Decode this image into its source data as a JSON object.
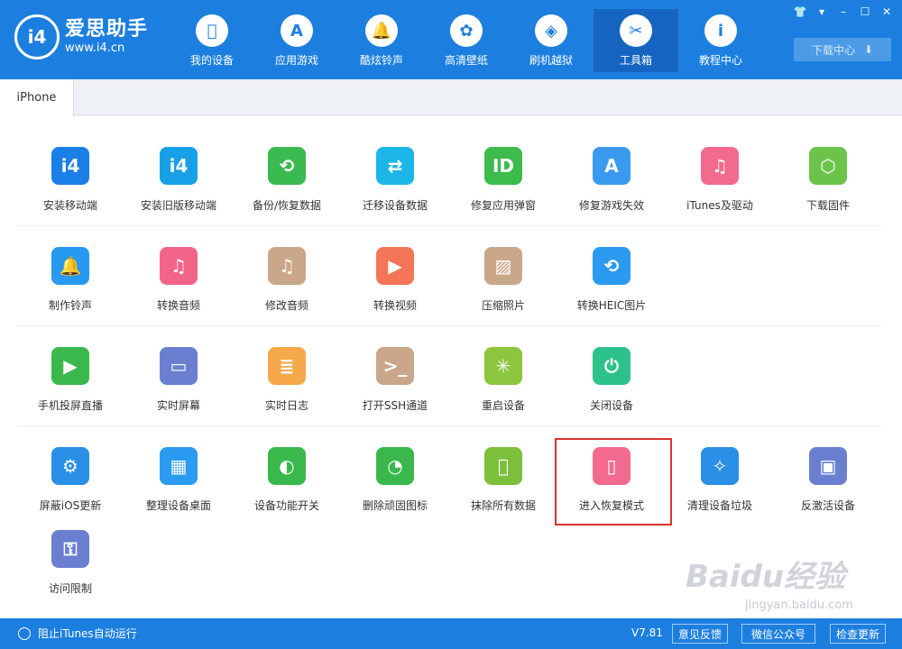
{
  "app": {
    "name": "爱思助手",
    "url": "www.i4.cn",
    "badge": "i4"
  },
  "nav": [
    {
      "label": "我的设备",
      "icon": "apple-icon",
      "glyph": ""
    },
    {
      "label": "应用游戏",
      "icon": "app-store-icon",
      "glyph": "A"
    },
    {
      "label": "酷炫铃声",
      "icon": "bell-icon",
      "glyph": "🔔"
    },
    {
      "label": "高清壁纸",
      "icon": "flower-icon",
      "glyph": "✿"
    },
    {
      "label": "刷机越狱",
      "icon": "dropbox-icon",
      "glyph": "◈"
    },
    {
      "label": "工具箱",
      "icon": "tools-icon",
      "glyph": "✂"
    },
    {
      "label": "教程中心",
      "icon": "info-icon",
      "glyph": "i"
    }
  ],
  "download_center": "下载中心",
  "tab": "iPhone",
  "tools": [
    [
      {
        "label": "安装移动端",
        "icon": "i4-app-icon",
        "color": "#1a7fe6",
        "glyph": "i4"
      },
      {
        "label": "安装旧版移动端",
        "icon": "i4-legacy-app-icon",
        "color": "#18a0e6",
        "glyph": "i4"
      },
      {
        "label": "备份/恢复数据",
        "icon": "backup-restore-icon",
        "color": "#3aba4f",
        "glyph": "⟲"
      },
      {
        "label": "迁移设备数据",
        "icon": "transfer-data-icon",
        "color": "#1cb6e8",
        "glyph": "⇄"
      },
      {
        "label": "修复应用弹窗",
        "icon": "apple-id-fix-icon",
        "color": "#3dbb4c",
        "glyph": "ID"
      },
      {
        "label": "修复游戏失效",
        "icon": "game-fix-icon",
        "color": "#3a9af0",
        "glyph": "A"
      },
      {
        "label": "iTunes及驱动",
        "icon": "itunes-icon",
        "color": "#f26a8d",
        "glyph": "♫"
      },
      {
        "label": "下载固件",
        "icon": "firmware-box-icon",
        "color": "#6cc34a",
        "glyph": "⬡"
      }
    ],
    [
      {
        "label": "制作铃声",
        "icon": "ringtone-bell-icon",
        "color": "#2799f0",
        "glyph": "🔔"
      },
      {
        "label": "转换音频",
        "icon": "convert-audio-icon",
        "color": "#f3648a",
        "glyph": "♫"
      },
      {
        "label": "修改音频",
        "icon": "edit-audio-icon",
        "color": "#caa78a",
        "glyph": "♫"
      },
      {
        "label": "转换视频",
        "icon": "convert-video-icon",
        "color": "#f47558",
        "glyph": "▶"
      },
      {
        "label": "压缩照片",
        "icon": "compress-photo-icon",
        "color": "#caa78a",
        "glyph": "▨"
      },
      {
        "label": "转换HEIC图片",
        "icon": "heic-convert-icon",
        "color": "#2a9bf0",
        "glyph": "⟲"
      }
    ],
    [
      {
        "label": "手机投屏直播",
        "icon": "screen-cast-icon",
        "color": "#3ab84c",
        "glyph": "▶"
      },
      {
        "label": "实时屏幕",
        "icon": "realtime-screen-icon",
        "color": "#6a7fd0",
        "glyph": "▭"
      },
      {
        "label": "实时日志",
        "icon": "realtime-log-icon",
        "color": "#f6a94a",
        "glyph": "≣"
      },
      {
        "label": "打开SSH通道",
        "icon": "ssh-terminal-icon",
        "color": "#caa78a",
        "glyph": ">_"
      },
      {
        "label": "重启设备",
        "icon": "restart-device-icon",
        "color": "#8cc63f",
        "glyph": "✳"
      },
      {
        "label": "关闭设备",
        "icon": "power-off-icon",
        "color": "#2dc28b",
        "glyph": "⏻"
      }
    ],
    [
      {
        "label": "屏蔽iOS更新",
        "icon": "block-update-icon",
        "color": "#2a8fe6",
        "glyph": "⚙"
      },
      {
        "label": "整理设备桌面",
        "icon": "organize-desktop-icon",
        "color": "#2a9bf0",
        "glyph": "▦"
      },
      {
        "label": "设备功能开关",
        "icon": "feature-toggle-icon",
        "color": "#3ab84c",
        "glyph": "◐"
      },
      {
        "label": "删除顽固图标",
        "icon": "delete-icon-icon",
        "color": "#3ab84c",
        "glyph": "◔"
      },
      {
        "label": "抹除所有数据",
        "icon": "erase-data-icon",
        "color": "#7cbf3a",
        "glyph": ""
      },
      {
        "label": "进入恢复模式",
        "icon": "recovery-mode-icon",
        "color": "#f26a8d",
        "glyph": "▯"
      },
      {
        "label": "清理设备垃圾",
        "icon": "clean-junk-icon",
        "color": "#2a8fe6",
        "glyph": "✧"
      },
      {
        "label": "反激活设备",
        "icon": "deactivate-device-icon",
        "color": "#6a7fd0",
        "glyph": "▣"
      }
    ],
    [
      {
        "label": "访问限制",
        "icon": "access-restriction-icon",
        "color": "#6a7fd0",
        "glyph": "⚿"
      }
    ]
  ],
  "footer": {
    "itunes_label": "阻止iTunes自动运行",
    "version": "V7.81",
    "feedback": "意见反馈",
    "wechat": "微信公众号",
    "check_update": "检查更新"
  },
  "watermark": {
    "text": "Baidu经验",
    "sub": "jingyan.baidu.com"
  }
}
